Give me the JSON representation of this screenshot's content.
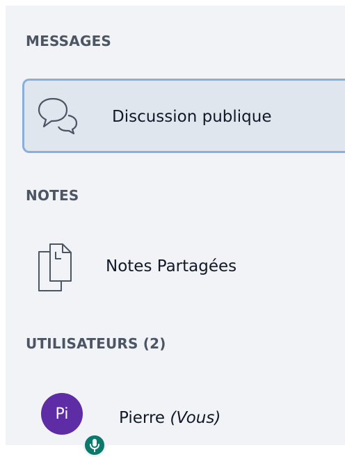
{
  "sections": {
    "messages": {
      "title": "MESSAGES",
      "items": [
        {
          "label": "Discussion publique",
          "icon": "chat-bubbles-icon",
          "selected": true
        }
      ]
    },
    "notes": {
      "title": "NOTES",
      "items": [
        {
          "label": "Notes Partagées",
          "icon": "documents-icon"
        }
      ]
    },
    "users": {
      "title": "UTILISATEURS (2)",
      "list": [
        {
          "initials": "Pi",
          "name": "Pierre",
          "suffix": "(Vous)",
          "avatar_color": "#5e2ca5",
          "badge_icon": "microphone-icon",
          "badge_color": "#0b7a6c"
        }
      ]
    }
  },
  "colors": {
    "panel_background": "#f1f3f6",
    "selected_background": "#dfe6ee",
    "selected_border": "#8aaedc",
    "section_title": "#4b5563",
    "text": "#111827"
  }
}
